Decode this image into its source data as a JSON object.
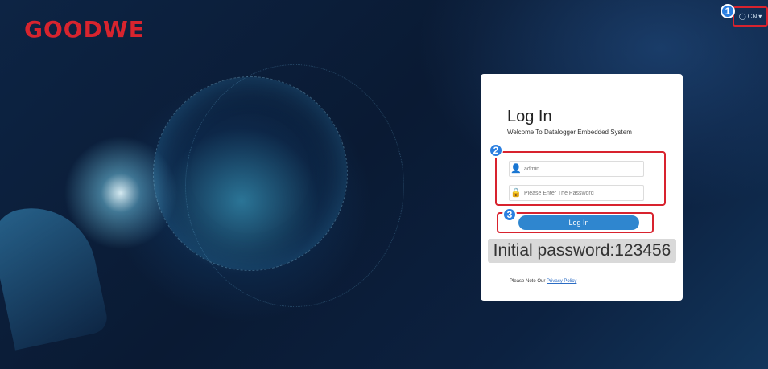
{
  "brand": {
    "logo_text": "GOODWE",
    "logo_color": "#d8242e"
  },
  "language": {
    "icon": "globe-icon",
    "label": "CN"
  },
  "markers": [
    "1",
    "2",
    "3"
  ],
  "login": {
    "title": "Log In",
    "subtitle": "Welcome To Datalogger Embedded System",
    "username": {
      "icon": "user-icon",
      "value": "admin"
    },
    "password": {
      "icon": "lock-icon",
      "placeholder": "Please Enter The Password"
    },
    "button_label": "Log In",
    "password_note": "Initial password:123456",
    "privacy_prefix": "Please Note Our ",
    "privacy_link": "Privacy Policy"
  },
  "colors": {
    "accent": "#2f86cf",
    "highlight": "#d8232e",
    "marker": "#2b7fe0"
  }
}
